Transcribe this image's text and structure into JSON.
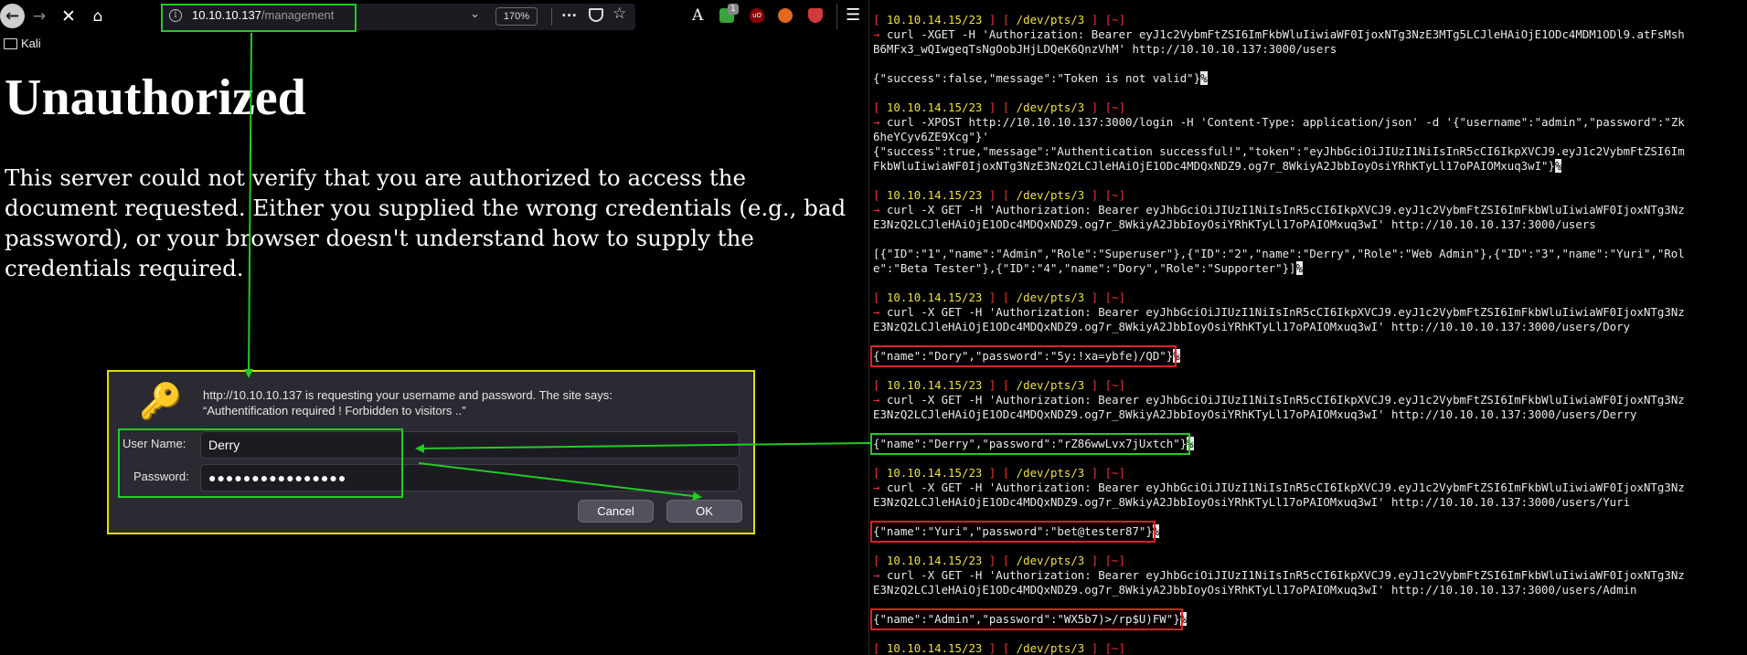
{
  "browser": {
    "url_host": "10.10.10.137",
    "url_path": "/management",
    "zoom": "170%",
    "extension_badge": "1",
    "bookmark_folder": "Kali",
    "page_title": "Unauthorized",
    "page_body": "This server could not verify that you are authorized to access the document requested. Either you supplied the wrong credentials (e.g., bad password), or your browser doesn't understand how to supply the credentials required.",
    "icons": {
      "back": "back-arrow-icon",
      "forward": "forward-arrow-icon",
      "stop": "close-icon",
      "home": "home-icon",
      "info": "info-icon",
      "more": "more-icon",
      "pocket": "pocket-icon",
      "bookmark": "star-icon",
      "reader": "reader-icon",
      "menu": "hamburger-menu-icon",
      "folder": "folder-icon"
    }
  },
  "dialog": {
    "message_line1": "http://10.10.10.137 is requesting your username and password. The site says:",
    "message_line2": "“Authentification required ! Forbidden to visitors ..”",
    "username_label": "User Name:",
    "username_value": "Derry",
    "password_label": "Password:",
    "password_value": "●●●●●●●●●●●●●●●●",
    "cancel_label": "Cancel",
    "ok_label": "OK",
    "key_icon": "key-icon"
  },
  "terminal": {
    "prompt": {
      "host": "10.10.14.15/23",
      "tty": "/dev/pts/3",
      "dir": "~",
      "arrow": "→"
    },
    "lines": [
      {
        "type": "prompt"
      },
      {
        "type": "cmd",
        "text": "curl -XGET -H 'Authorization: Bearer eyJ1c2VybmFtZSI6ImFkbWluIiwiaWF0IjoxNTg3NzE3MTg5LCJleHAiOjE1ODc4MDM1ODl9.atFsMsh"
      },
      {
        "type": "out",
        "text": "B6MFx3_wQIwgeqTsNgOobJHjLDQeK6QnzVhM' http://10.10.10.137:3000/users"
      },
      {
        "type": "blank"
      },
      {
        "type": "out",
        "text": "{\"success\":false,\"message\":\"Token is not valid\"}",
        "cursor": "%"
      },
      {
        "type": "blank"
      },
      {
        "type": "prompt"
      },
      {
        "type": "cmd",
        "text": "curl -XPOST http://10.10.10.137:3000/login -H 'Content-Type: application/json' -d '{\"username\":\"admin\",\"password\":\"Zk"
      },
      {
        "type": "out",
        "text": "6heYCyv6ZE9Xcg\"}'"
      },
      {
        "type": "out",
        "text": "{\"success\":true,\"message\":\"Authentication successful!\",\"token\":\"eyJhbGciOiJIUzI1NiIsInR5cCI6IkpXVCJ9.eyJ1c2VybmFtZSI6Im"
      },
      {
        "type": "out",
        "text": "FkbWluIiwiaWF0IjoxNTg3NzE3NzQ2LCJleHAiOjE1ODc4MDQxNDZ9.og7r_8WkiyA2JbbIoyOsiYRhKTyLl17oPAIOMxuq3wI\"}",
        "cursor": "%"
      },
      {
        "type": "blank"
      },
      {
        "type": "prompt"
      },
      {
        "type": "cmd",
        "text": "curl -X GET -H 'Authorization: Bearer eyJhbGciOiJIUzI1NiIsInR5cCI6IkpXVCJ9.eyJ1c2VybmFtZSI6ImFkbWluIiwiaWF0IjoxNTg3Nz"
      },
      {
        "type": "out",
        "text": "E3NzQ2LCJleHAiOjE1ODc4MDQxNDZ9.og7r_8WkiyA2JbbIoyOsiYRhKTyLl17oPAIOMxuq3wI' http://10.10.10.137:3000/users"
      },
      {
        "type": "blank"
      },
      {
        "type": "out",
        "text": "[{\"ID\":\"1\",\"name\":\"Admin\",\"Role\":\"Superuser\"},{\"ID\":\"2\",\"name\":\"Derry\",\"Role\":\"Web Admin\"},{\"ID\":\"3\",\"name\":\"Yuri\",\"Rol"
      },
      {
        "type": "out",
        "text": "e\":\"Beta Tester\"},{\"ID\":\"4\",\"name\":\"Dory\",\"Role\":\"Supporter\"}]",
        "cursor": "%"
      },
      {
        "type": "blank"
      },
      {
        "type": "prompt"
      },
      {
        "type": "cmd",
        "text": "curl -X GET -H 'Authorization: Bearer eyJhbGciOiJIUzI1NiIsInR5cCI6IkpXVCJ9.eyJ1c2VybmFtZSI6ImFkbWluIiwiaWF0IjoxNTg3Nz"
      },
      {
        "type": "out",
        "text": "E3NzQ2LCJleHAiOjE1ODc4MDQxNDZ9.og7r_8WkiyA2JbbIoyOsiYRhKTyLl17oPAIOMxuq3wI' http://10.10.10.137:3000/users/Dory"
      },
      {
        "type": "blank"
      },
      {
        "type": "out",
        "text": "{\"name\":\"Dory\",\"password\":\"5y:!xa=ybfe)/QD\"}",
        "cursor": "%",
        "box": "red"
      },
      {
        "type": "blank"
      },
      {
        "type": "prompt"
      },
      {
        "type": "cmd",
        "text": "curl -X GET -H 'Authorization: Bearer eyJhbGciOiJIUzI1NiIsInR5cCI6IkpXVCJ9.eyJ1c2VybmFtZSI6ImFkbWluIiwiaWF0IjoxNTg3Nz"
      },
      {
        "type": "out",
        "text": "E3NzQ2LCJleHAiOjE1ODc4MDQxNDZ9.og7r_8WkiyA2JbbIoyOsiYRhKTyLl17oPAIOMxuq3wI' http://10.10.10.137:3000/users/Derry"
      },
      {
        "type": "blank"
      },
      {
        "type": "out",
        "text": "{\"name\":\"Derry\",\"password\":\"rZ86wwLvx7jUxtch\"}",
        "cursor": "%",
        "box": "green"
      },
      {
        "type": "blank"
      },
      {
        "type": "prompt"
      },
      {
        "type": "cmd",
        "text": "curl -X GET -H 'Authorization: Bearer eyJhbGciOiJIUzI1NiIsInR5cCI6IkpXVCJ9.eyJ1c2VybmFtZSI6ImFkbWluIiwiaWF0IjoxNTg3Nz"
      },
      {
        "type": "out",
        "text": "E3NzQ2LCJleHAiOjE1ODc4MDQxNDZ9.og7r_8WkiyA2JbbIoyOsiYRhKTyLl17oPAIOMxuq3wI' http://10.10.10.137:3000/users/Yuri"
      },
      {
        "type": "blank"
      },
      {
        "type": "out",
        "text": "{\"name\":\"Yuri\",\"password\":\"bet@tester87\"}",
        "cursor": "%",
        "box": "red"
      },
      {
        "type": "blank"
      },
      {
        "type": "prompt"
      },
      {
        "type": "cmd",
        "text": "curl -X GET -H 'Authorization: Bearer eyJhbGciOiJIUzI1NiIsInR5cCI6IkpXVCJ9.eyJ1c2VybmFtZSI6ImFkbWluIiwiaWF0IjoxNTg3Nz"
      },
      {
        "type": "out",
        "text": "E3NzQ2LCJleHAiOjE1ODc4MDQxNDZ9.og7r_8WkiyA2JbbIoyOsiYRhKTyLl17oPAIOMxuq3wI' http://10.10.10.137:3000/users/Admin"
      },
      {
        "type": "blank"
      },
      {
        "type": "out",
        "text": "{\"name\":\"Admin\",\"password\":\"WX5b7)>/rp$U)FW\"}",
        "cursor": "%",
        "box": "red"
      },
      {
        "type": "blank"
      },
      {
        "type": "prompt"
      }
    ]
  },
  "colors": {
    "highlight_green": "#22cc22",
    "highlight_red": "#e02020",
    "dialog_border": "#e0e000",
    "prompt_red": "#e33",
    "prompt_yellow": "#f0e040"
  }
}
